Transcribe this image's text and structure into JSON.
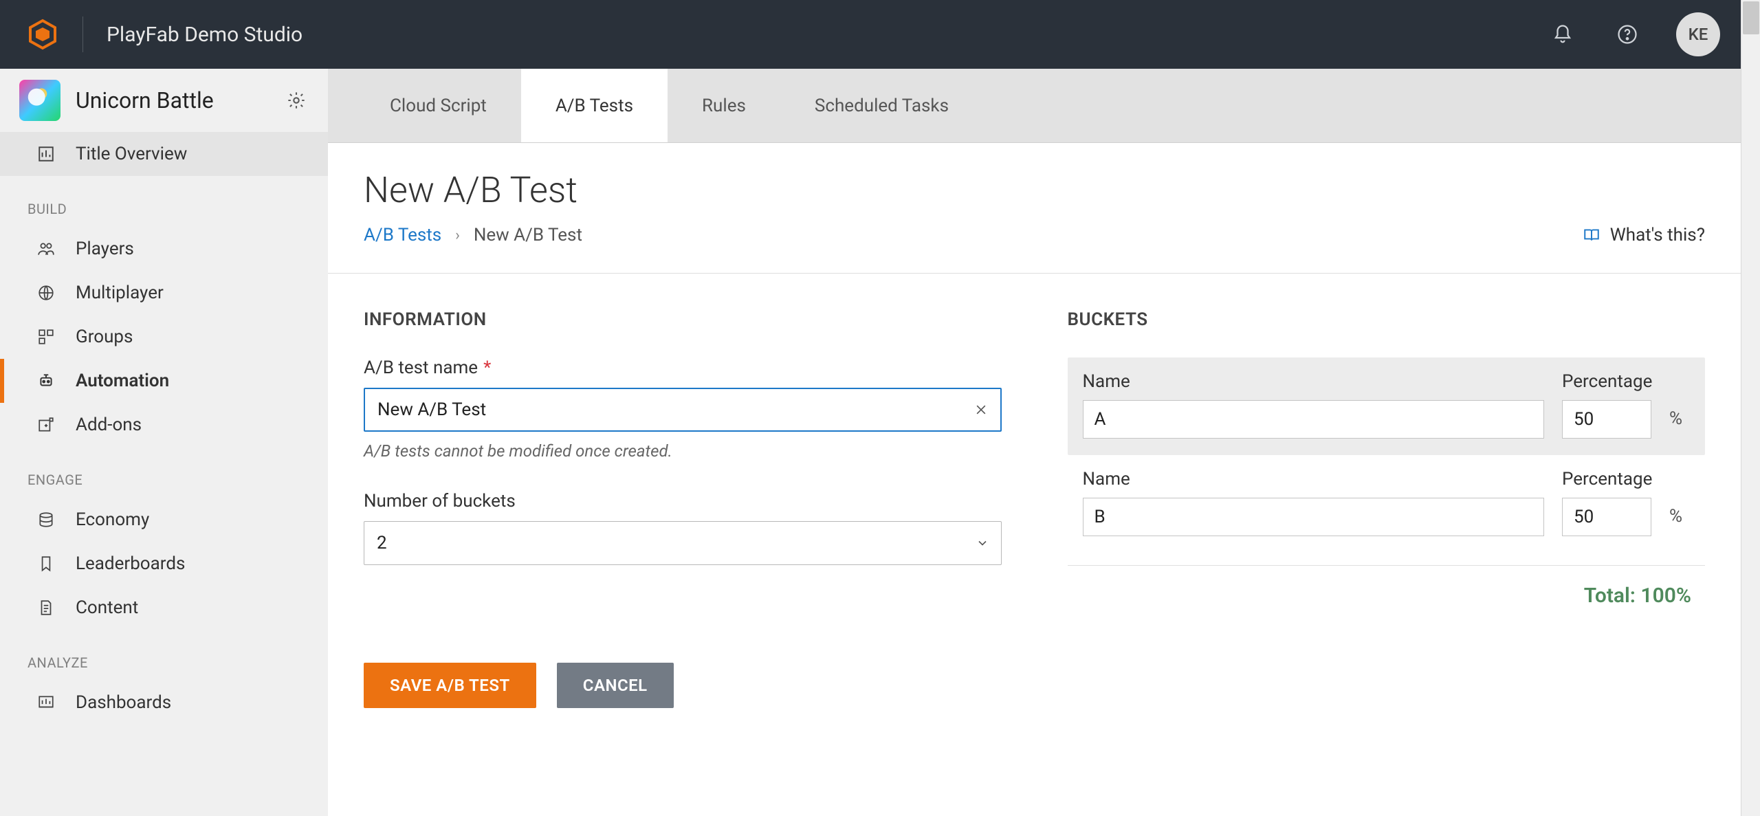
{
  "header": {
    "studio_name": "PlayFab Demo Studio",
    "avatar_initials": "KE"
  },
  "sidebar": {
    "title_name": "Unicorn Battle",
    "overview_label": "Title Overview",
    "section_build": "BUILD",
    "section_engage": "ENGAGE",
    "section_analyze": "ANALYZE",
    "items_build": [
      {
        "label": "Players"
      },
      {
        "label": "Multiplayer"
      },
      {
        "label": "Groups"
      },
      {
        "label": "Automation"
      },
      {
        "label": "Add-ons"
      }
    ],
    "items_engage": [
      {
        "label": "Economy"
      },
      {
        "label": "Leaderboards"
      },
      {
        "label": "Content"
      }
    ],
    "items_analyze": [
      {
        "label": "Dashboards"
      }
    ]
  },
  "tabs": [
    {
      "label": "Cloud Script"
    },
    {
      "label": "A/B Tests"
    },
    {
      "label": "Rules"
    },
    {
      "label": "Scheduled Tasks"
    }
  ],
  "page": {
    "title": "New A/B Test",
    "breadcrumb_root": "A/B Tests",
    "breadcrumb_current": "New A/B Test",
    "whats_this": "What's this?",
    "information_heading": "INFORMATION",
    "buckets_heading": "BUCKETS",
    "name_label": "A/B test name",
    "name_value": "New A/B Test",
    "name_hint": "A/B tests cannot be modified once created.",
    "buckets_count_label": "Number of buckets",
    "buckets_count_value": "2",
    "bucket_name_label": "Name",
    "bucket_pct_label": "Percentage",
    "pct_unit": "%",
    "buckets": [
      {
        "name": "A",
        "pct": "50"
      },
      {
        "name": "B",
        "pct": "50"
      }
    ],
    "total_label": "Total: 100%",
    "save_label": "SAVE A/B TEST",
    "cancel_label": "CANCEL"
  }
}
